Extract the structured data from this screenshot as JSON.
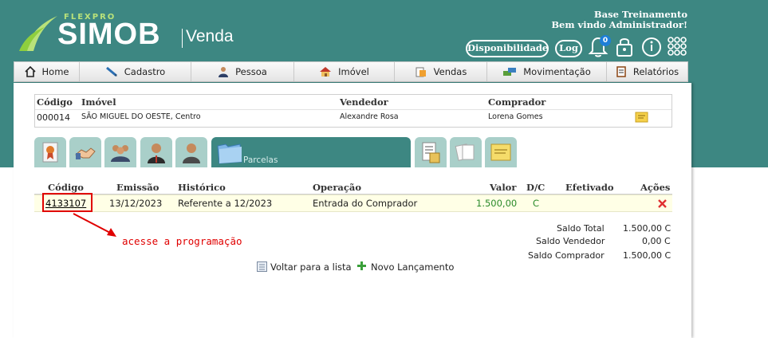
{
  "header": {
    "brand_small": "FLEXPRO",
    "brand": "SIMOB",
    "module": "Venda",
    "greeting_line1": "Base Treinamento",
    "greeting_line2": "Bem vindo Administrador!",
    "availability_label": "Disponibilidade",
    "log_label": "Log",
    "notification_count": "0"
  },
  "nav": {
    "items": [
      {
        "label": "Home",
        "icon": "home-icon"
      },
      {
        "label": "Cadastro",
        "icon": "pencil-icon"
      },
      {
        "label": "Pessoa",
        "icon": "person-icon"
      },
      {
        "label": "Imóvel",
        "icon": "house-icon"
      },
      {
        "label": "Vendas",
        "icon": "sales-icon"
      },
      {
        "label": "Movimentação",
        "icon": "transfer-icon"
      },
      {
        "label": "Relatórios",
        "icon": "report-icon"
      }
    ]
  },
  "summary": {
    "headers": {
      "code": "Código",
      "property": "Imóvel",
      "seller": "Vendedor",
      "buyer": "Comprador"
    },
    "row": {
      "code": "000014",
      "property": "SÃO MIGUEL DO OESTE, Centro",
      "seller": "Alexandre Rosa",
      "buyer": "Lorena Gomes"
    }
  },
  "tabs": {
    "active_label": "Parcelas"
  },
  "installments": {
    "headers": {
      "code": "Código",
      "issue": "Emissão",
      "history": "Histórico",
      "operation": "Operação",
      "value": "Valor",
      "dc": "D/C",
      "done": "Efetivado",
      "actions": "Ações"
    },
    "rows": [
      {
        "code": "4133107",
        "issue": "13/12/2023",
        "history": "Referente a 12/2023",
        "operation": "Entrada do Comprador",
        "value": "1.500,00",
        "dc": "C"
      }
    ]
  },
  "annotation": "acesse a programação",
  "totals": {
    "total_label": "Saldo Total",
    "total_value": "1.500,00 C",
    "seller_label": "Saldo Vendedor",
    "seller_value": "0,00 C",
    "buyer_label": "Saldo Comprador",
    "buyer_value": "1.500,00 C"
  },
  "footer": {
    "back_label": "Voltar para a lista",
    "new_label": "Novo Lançamento"
  },
  "colors": {
    "brand_teal": "#3d8782",
    "alert_red": "#e00000",
    "value_green": "#2a8a2a"
  }
}
